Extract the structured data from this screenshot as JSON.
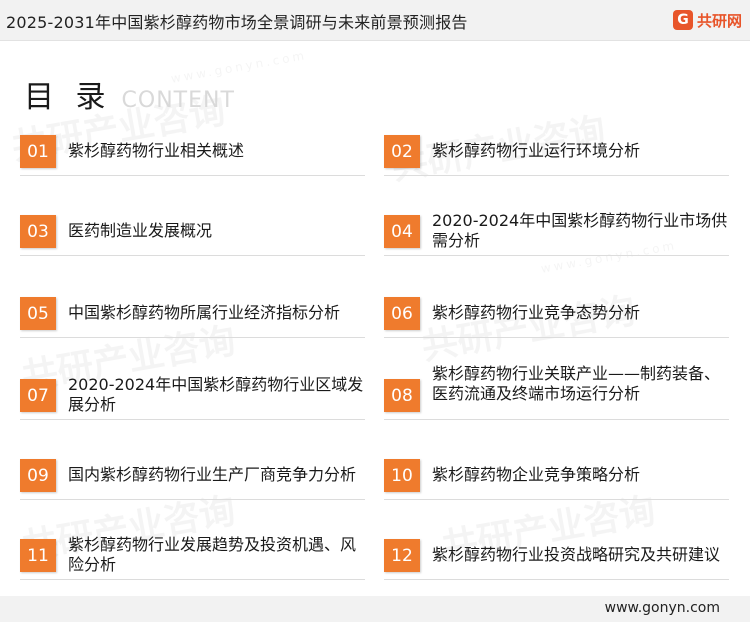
{
  "header": {
    "title": "2025-2031年中国紫杉醇药物市场全景调研与未来前景预测报告",
    "logo_mark": "G",
    "logo_text": "共研网"
  },
  "heading": {
    "cn": "目 录",
    "en": "CONTENT"
  },
  "watermark": {
    "text": "共研产业咨询",
    "sub": "www.gonyn.com"
  },
  "items": [
    {
      "num": "01",
      "label": "紫杉醇药物行业相关概述"
    },
    {
      "num": "02",
      "label": "紫杉醇药物行业运行环境分析"
    },
    {
      "num": "03",
      "label": "医药制造业发展概况"
    },
    {
      "num": "04",
      "label": "2020-2024年中国紫杉醇药物行业市场供需分析"
    },
    {
      "num": "05",
      "label": "中国紫杉醇药物所属行业经济指标分析"
    },
    {
      "num": "06",
      "label": "紫杉醇药物行业竞争态势分析"
    },
    {
      "num": "07",
      "label": "2020-2024年中国紫杉醇药物行业区域发展分析"
    },
    {
      "num": "08",
      "label": "紫杉醇药物行业关联产业——制药装备、医药流通及终端市场运行分析"
    },
    {
      "num": "09",
      "label": "国内紫杉醇药物行业生产厂商竞争力分析"
    },
    {
      "num": "10",
      "label": "紫杉醇药物企业竞争策略分析"
    },
    {
      "num": "11",
      "label": "紫杉醇药物行业发展趋势及投资机遇、风险分析"
    },
    {
      "num": "12",
      "label": "紫杉醇药物行业投资战略研究及共研建议"
    }
  ],
  "footer": {
    "url": "www.gonyn.com"
  },
  "colors": {
    "accent": "#ef7b2d",
    "brand": "#e8552a"
  }
}
